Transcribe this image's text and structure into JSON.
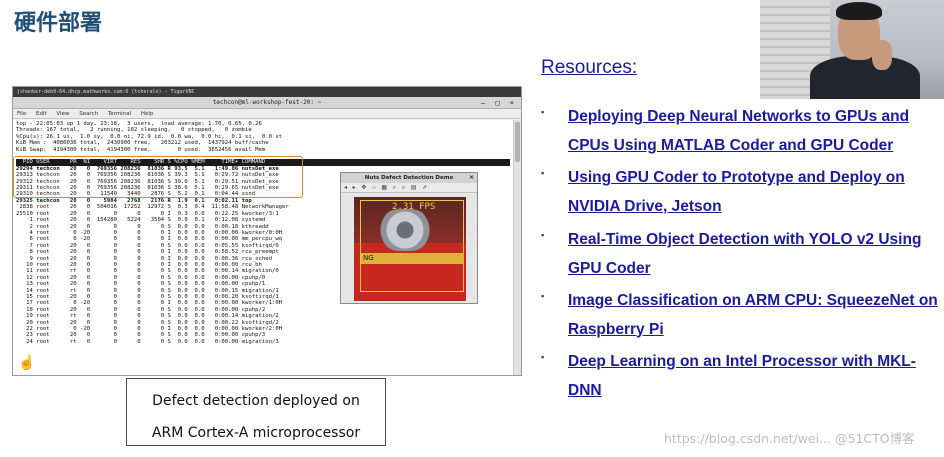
{
  "slide": {
    "title": "硬件部署",
    "resources_heading": "Resources:",
    "links": [
      "Deploying Deep Neural Networks to GPUs and CPUs Using MATLAB Coder and GPU Coder",
      "Using GPU Coder to Prototype and Deploy on NVIDIA Drive, Jetson",
      "Real-Time Object Detection with YOLO v2 Using GPU Coder",
      "Image Classification on ARM CPU: SqueezeNet on Raspberry Pi",
      "Deep Learning on an Intel Processor with MKL-DNN"
    ],
    "caption_line1": "Defect detection deployed on",
    "caption_line2": "ARM Cortex-A microprocessor",
    "watermark": "https://blog.csdn.net/wei... @51CTO博客"
  },
  "terminal": {
    "outer_title": "jshanker-deb9-64.dhcp.mathworks.com:6 (tcheralo) - TigerVNC",
    "window_title": "techcon@ml-workshop-fest-20: ~",
    "menu": [
      "File",
      "Edit",
      "View",
      "Search",
      "Terminal",
      "Help"
    ],
    "lines": [
      "top - 22:05:03 up 1 day, 23:18,  3 users,  load average: 1.70, 0.65, 0.26",
      "Threads: 167 total,   2 running, 102 sleeping,   0 stopped,   0 zombie",
      "%Cpu(s): 26.1 us,  1.0 sy,  0.0 ni, 72.9 id,  0.0 wa,  0.0 hi,  0.1 si,  0.0 st",
      "KiB Mem :  4080036 total,  2430900 free,   203212 used,  1437924 buff/cache",
      "KiB Swap:  4194300 total,  4194300 free,        0 used.  3652456 avail Mem",
      "",
      "  PID USER      PR  NI    VIRT    RES    SHR S %CPU %MEM     TIME+ COMMAND",
      "29294 techcon   20   0  769356 208236  81036 R 93.5  5.1   1:49.06 nutsDet_exe",
      "29313 techcon   20   0  769356 208236  81036 S 39.3  5.1   0:29.72 nutsDet_exe",
      "29312 techcon   20   0  769356 208236  81036 S 39.0  5.1   0:29.51 nutsDet_exe",
      "29311 techcon   20   0  769356 208236  81036 S 38.6  5.1   0:29.65 nutsDet_exe",
      "29310 techcon   20   0   11540   3440   2876 S  5.2  0.1   0:04.44 zsnd",
      "29325 techcon   20   0    5984   2768   2176 R  1.9  0.1   0:02.11 top",
      " 2838 root      20   0  504016  17252  12972 S  0.3  0.4  11:58.48 NetworkManager",
      "25510 root      20   0       0      0      0 I  0.3  0.0   0:22.25 kworker/3:1",
      "    1 root      20   0  154280   5224   3504 S  0.0  0.1   0:12.08 systemd",
      "    2 root      20   0       0      0      0 S  0.0  0.0   0:00.18 kthreadd",
      "    4 root       0 -20       0      0      0 I  0.0  0.0   0:00.00 kworker/0:0H",
      "    6 root       0 -20       0      0      0 I  0.0  0.0   0:00.00 mm_percpu_wq",
      "    7 root      20   0       0      0      0 S  0.0  0.0   0:05.55 ksoftirqd/0",
      "    8 root      20   0       0      0      0 I  0.0  0.0   0:58.52 rcu_preempt",
      "    9 root      20   0       0      0      0 I  0.0  0.0   0:00.36 rcu_sched",
      "   10 root      20   0       0      0      0 I  0.0  0.0   0:00.00 rcu_bh",
      "   11 root      rt   0       0      0      0 S  0.0  0.0   0:00.14 migration/0",
      "   12 root      20   0       0      0      0 S  0.0  0.0   0:00.00 cpuhp/0",
      "   13 root      20   0       0      0      0 S  0.0  0.0   0:00.00 cpuhp/1",
      "   14 root      rt   0       0      0      0 S  0.0  0.0   0:00.15 migration/1",
      "   15 root      20   0       0      0      0 S  0.0  0.0   0:00.20 ksoftirqd/1",
      "   17 root       0 -20       0      0      0 I  0.0  0.0   0:00.00 kworker/1:0H",
      "   18 root      20   0       0      0      0 S  0.0  0.0   0:00.00 cpuhp/2",
      "   19 root      rt   0       0      0      0 S  0.0  0.0   0:00.14 migration/2",
      "   20 root      20   0       0      0      0 S  0.0  0.0   0:00.22 ksoftirqd/2",
      "   22 root       0 -20       0      0      0 I  0.0  0.0   0:00.00 kworker/2:0H",
      "   23 root      20   0       0      0      0 S  0.0  0.0   0:00.00 cpuhp/3",
      "   24 root      rt   0       0      0      0 S  0.0  0.0   0:00.00 migration/3"
    ]
  },
  "nuts_window": {
    "title": "Nuts Defect Detection Demo",
    "toolbar_icons": "◂ ▸ ✥ ⌂ ▦ ⌕ ⌕ ▤ ➚",
    "fps_text": "2.31 FPS",
    "label": "NG"
  },
  "colors": {
    "title": "#1f4e79",
    "link": "#1a1aa0",
    "highlight_box": "#e08a1e",
    "defect_bg": "#c6281f"
  }
}
